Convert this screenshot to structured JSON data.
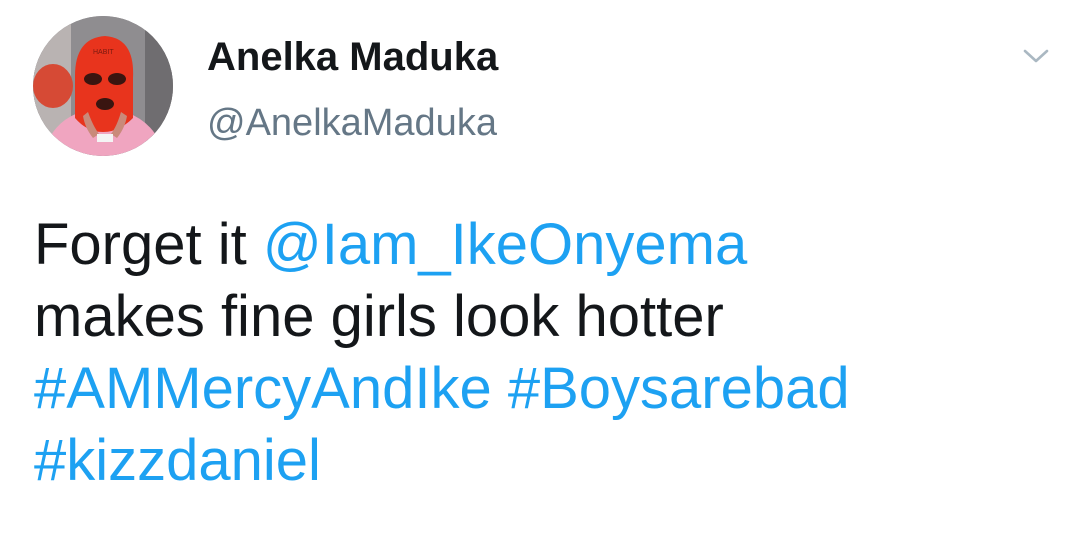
{
  "user": {
    "display_name": "Anelka Maduka",
    "handle": "@AnelkaMaduka",
    "avatar_icon": "profile-photo-red-ski-mask"
  },
  "menu": {
    "icon": "chevron-down-icon"
  },
  "tweet": {
    "text_1": "Forget it ",
    "mention": "@Iam_IkeOnyema",
    "text_2": "makes fine girls look hotter",
    "hashtag_1": "#AMMercyAndIke",
    "hashtag_2": "#Boysarebad",
    "hashtag_3": "#kizzdaniel"
  },
  "colors": {
    "link": "#1da1f2",
    "text": "#14171a",
    "secondary": "#657786",
    "background": "#ffffff"
  }
}
